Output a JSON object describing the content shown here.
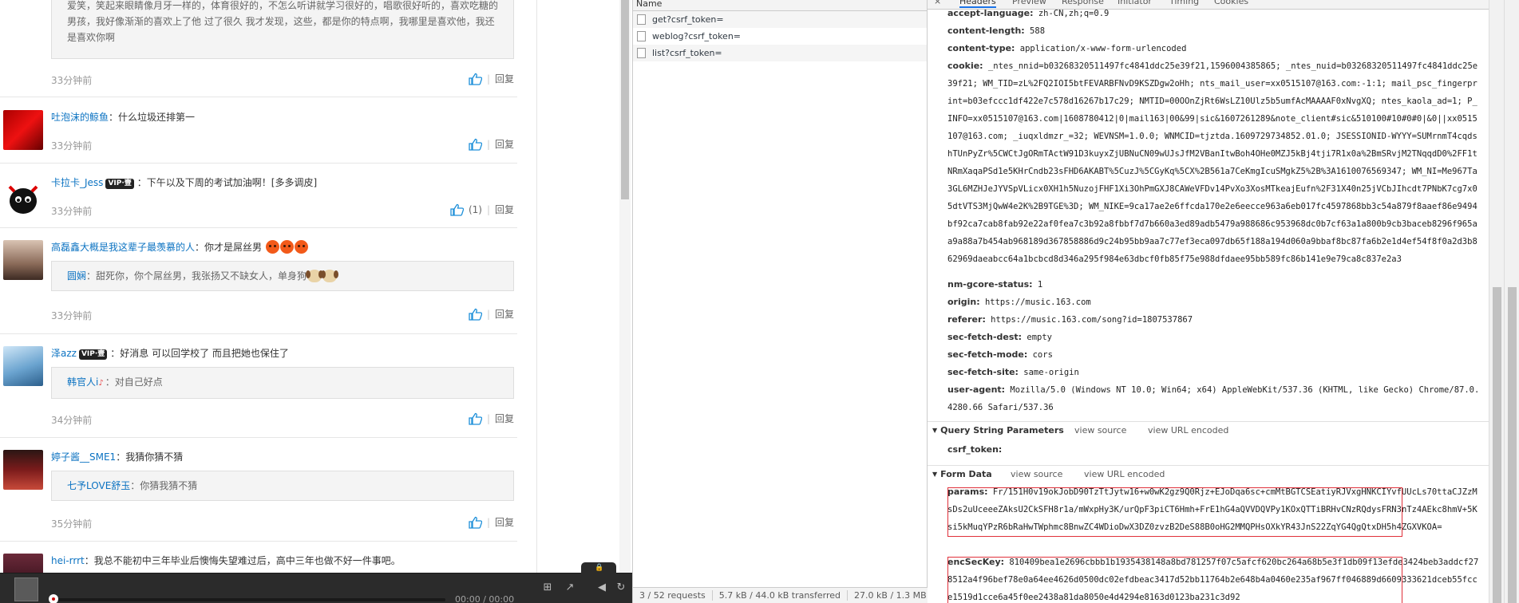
{
  "comments": [
    {
      "text": "爱笑，笑起来眼睛像月牙一样的，体育很好的，不怎么听讲就学习很好的，唱歌很好听的，喜欢吃糖的男孩，我好像渐渐的喜欢上了他 过了很久 我才发现，这些，都是你的特点啊，我哪里是喜欢他，我还是喜欢你啊",
      "time": "33分钟前",
      "reply": "回复"
    },
    {
      "user": "吐泡沫的鲸鱼",
      "text": "：什么垃圾还排第一",
      "time": "33分钟前",
      "reply": "回复"
    },
    {
      "user": "卡拉卡_Jess",
      "vip": "VIP·壹",
      "text": "：下午以及下周的考试加油啊！[多多调皮]",
      "time": "33分钟前",
      "likes": "(1)",
      "reply": "回复"
    },
    {
      "user": "高磊鑫大概是我这辈子最羡慕的人",
      "text": "：你才是屌丝男",
      "quote_user": "圆娴",
      "quote_text": "：甜死你，你个屌丝男，我张扬又不缺女人，单身狗",
      "time": "33分钟前",
      "reply": "回复"
    },
    {
      "user": "泽azz",
      "vip": "VIP·壹",
      "text": "：好消息 可以回学校了 而且把她也保住了",
      "quote_user": "韩官人i",
      "quote_text": "：对自己好点",
      "time": "34分钟前",
      "reply": "回复"
    },
    {
      "user": "婷子酱__SME1",
      "text": "：我猜你猜不猜",
      "quote_user": "七予LOVE舒玉",
      "quote_text": "：你猜我猜不猜",
      "time": "35分钟前",
      "reply": "回复"
    },
    {
      "user": "hei-rrrt",
      "text": "：我总不能初中三年毕业后懊悔失望难过后，高中三年也做不好一件事吧。"
    }
  ],
  "player": {
    "time": "00:00 / 00:00"
  },
  "network": {
    "col_name": "Name",
    "requests": [
      "get?csrf_token=",
      "weblog?csrf_token=",
      "list?csrf_token="
    ],
    "status": {
      "requests": "3 / 52 requests",
      "transferred": "5.7 kB / 44.0 kB transferred",
      "resources": "27.0 kB / 1.3 MB resources"
    }
  },
  "tabs": {
    "close": "×",
    "headers": "Headers",
    "preview": "Preview",
    "response": "Response",
    "initiator": "Initiator",
    "timing": "Timing",
    "cookies": "Cookies"
  },
  "headers": [
    {
      "key": "accept-language:",
      "value": "zh-CN,zh;q=0.9"
    },
    {
      "key": "content-length:",
      "value": "588"
    },
    {
      "key": "content-type:",
      "value": "application/x-www-form-urlencoded"
    },
    {
      "key": "cookie:",
      "value": "_ntes_nnid=b03268320511497fc4841ddc25e39f21,1596004385865; _ntes_nuid=b03268320511497fc4841ddc25e39f21; WM_TID=zL%2FQ2IOI5btFEVARBFNvD9KSZDgw2oHh; nts_mail_user=xx0515107@163.com:-1:1; mail_psc_fingerprint=b03efccc1df422e7c578d16267b17c29; NMTID=00OOnZjRt6WsLZ10Ulz5b5umfAcMAAAAF0xNvgXQ; ntes_kaola_ad=1; P_INFO=xx0515107@163.com|1608780412|0|mail163|00&99|sic&1607261289&note_client#sic&510100#10#0#0|&0||xx0515107@163.com; _iuqxldmzr_=32; WEVNSM=1.0.0; WNMCID=tjztda.1609729734852.01.0; JSESSIONID-WYYY=SUMrnmT4cqdshTUnPyZr%5CWCtJgORmTActW91D3kuyxZjUBNuCN09wUJsJfM2VBanItwBoh4OHe0MZJ5kBj4tji7R1x0a%2BmSRvjM2TNqqdD0%2FF1tNRmXaqaPSd1e5KHrCndb23sFHD6AKABT%5CuzJ%5CGyKq%5CX%2B561a7CeKmgIcuSMgkZ5%2B%3A1610076569347; WM_NI=Me967Ta3GL6MZHJeJYVSpVLicx0XH1h5NuzojFHF1Xi3OhPmGXJ8CAWeVFDv14PvXo3XosMTkeajEufn%2F31X40n25jVCbJIhcdt7PNbK7cg7x05dtVTS3MjQwW4e2K%2B9TGE%3D; WM_NIKE=9ca17ae2e6ffcda170e2e6eecce963a6eb017fc4597868bb3c54a879f8aaef86e9494bf92ca7cab8fab92e22af0fea7c3b92a8fbbf7d7b660a3ed89adb5479a988686c953968dc0b7cf63a1a800b9cb3baceb8296f965aa9a88a7b454ab968189d367858886d9c24b95bb9aa7c77ef3eca097db65f188a194d060a9bbaf8bc87fa6b2e1d4ef54f8f0a2d3b862969daeabcc64a1bcbcd8d346a295f984e63dbcf0fb85f75e988dfdaee95bb589fc86b141e9e79ca8c837e2a3"
    },
    {
      "key": "nm-gcore-status:",
      "value": "1"
    },
    {
      "key": "origin:",
      "value": "https://music.163.com"
    },
    {
      "key": "referer:",
      "value": "https://music.163.com/song?id=1807537867"
    },
    {
      "key": "sec-fetch-dest:",
      "value": "empty"
    },
    {
      "key": "sec-fetch-mode:",
      "value": "cors"
    },
    {
      "key": "sec-fetch-site:",
      "value": "same-origin"
    },
    {
      "key": "user-agent:",
      "value": "Mozilla/5.0 (Windows NT 10.0; Win64; x64) AppleWebKit/537.36 (KHTML, like Gecko) Chrome/87.0.4280.66 Safari/537.36"
    }
  ],
  "qsp": {
    "title": "Query String Parameters",
    "view_source": "view source",
    "view_encoded": "view URL encoded",
    "key": "csrf_token:",
    "value": ""
  },
  "form": {
    "title": "Form Data",
    "view_source": "view source",
    "view_encoded": "view URL encoded",
    "params_key": "params:",
    "params_value": "Fr/151H0v19okJobD90TzTtJytw16+w0wK2gz9Q0Rjz+EJoDqa6sc+cmMtBGTCSEatiyRJVxgHNKCIYvfUUcLs70ttaCJZzMsDs2uUceeeZAksU2CkSFH8r1a/mWxpHy3K/urQpF3piCT6Hmh+FrE1hG4aQVVDQVPy1KOxQTTiBRHvCNzRQdysFRN3nTz4AEkc8hmV+5Ksi5kMuqYPzR6bRaHwTWphmc8BnwZC4WDioDwX3DZ0zvzB2DeS88B0oHG2MMQPHsOXkYR43JnS22ZqYG4QgQtxDH5h4ZGXVKOA=",
    "enc_key": "encSecKey:",
    "enc_value": "810409bea1e2696cbbb1b1935438148a8bd781257f07c5afcf620bc264a68b5e3f1db09f13efde3424beb3addcf278512a4f96bef78e0a64ee4626d0500dc02efdbeac3417d52bb11764b2e648b4a0460e235af967ff046889d6609333621dceb55fcce1519d1cce6a45f0ee2438a81da8050e4d4294e8163d0123ba231c3d92"
  }
}
